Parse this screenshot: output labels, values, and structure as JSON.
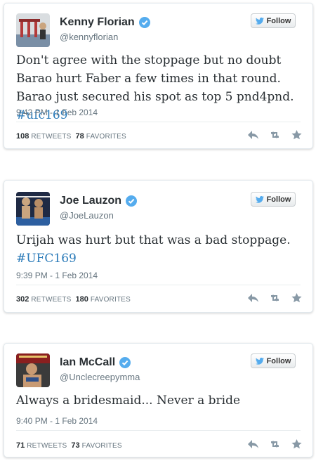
{
  "follow_label": "Follow",
  "retweets_label": "RETWEETS",
  "favorites_label": "FAVORITES",
  "colors": {
    "link": "#2b7bb9",
    "verified": "#55acee",
    "text": "#292f33",
    "muted": "#66757f"
  },
  "tweets": [
    {
      "name": "Kenny Florian",
      "handle": "@kennyflorian",
      "text": "Don't agree with the stoppage but no doubt Barao hurt Faber a few times in that round. Barao just secured his spot as top 5 pnd4pnd.",
      "hashtag": "#ufc169",
      "time": "9:42 PM - 1 Feb 2014",
      "retweets": "108",
      "favorites": "78"
    },
    {
      "name": "Joe Lauzon",
      "handle": "@JoeLauzon",
      "text": "Urijah was hurt but that was a bad stoppage.",
      "hashtag": "#UFC169",
      "time": "9:39 PM - 1 Feb 2014",
      "retweets": "302",
      "favorites": "180"
    },
    {
      "name": "Ian McCall",
      "handle": "@Unclecreepymma",
      "text": "Always a bridesmaid... Never a bride",
      "hashtag": "",
      "time": "9:40 PM - 1 Feb 2014",
      "retweets": "71",
      "favorites": "73"
    }
  ]
}
